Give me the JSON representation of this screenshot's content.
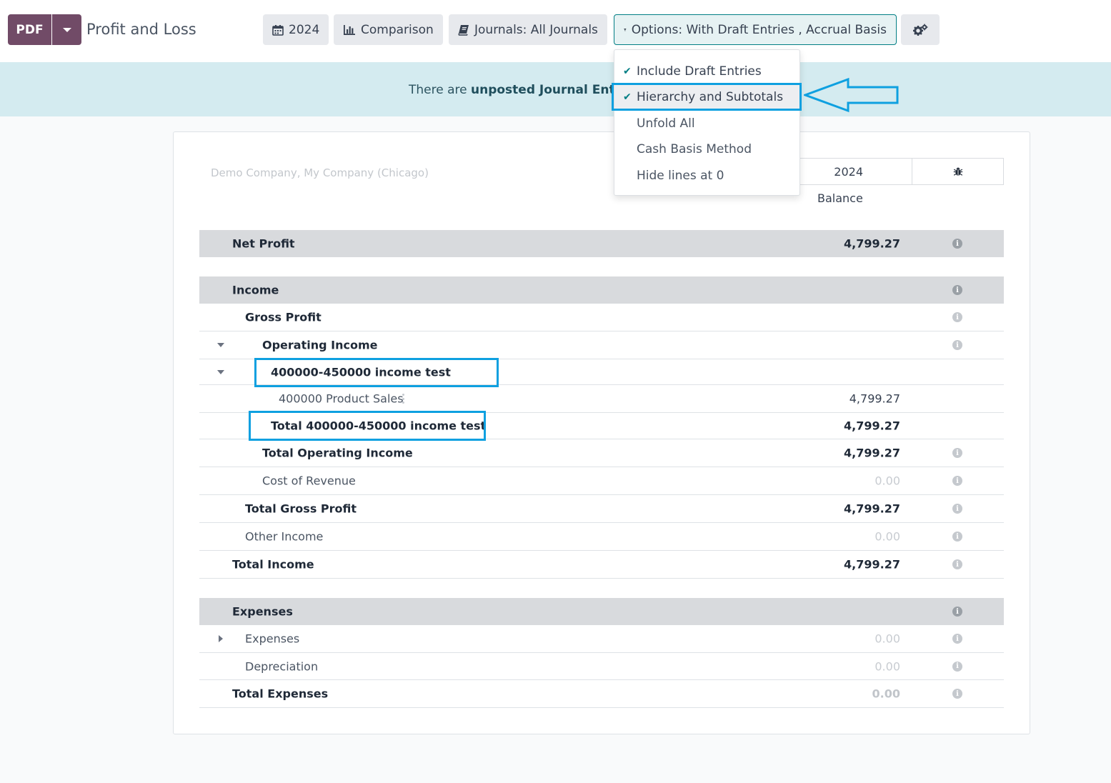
{
  "header": {
    "pdf_label": "PDF",
    "title": "Profit and Loss",
    "buttons": {
      "period": "2024",
      "comparison": "Comparison",
      "journals": "Journals: All Journals",
      "options": "Options: With Draft Entries , Accrual Basis"
    }
  },
  "banner": {
    "prefix": "There are ",
    "link": "unposted Journal Entries"
  },
  "options_menu": {
    "items": [
      {
        "label": "Include Draft Entries",
        "checked": true
      },
      {
        "label": "Hierarchy and Subtotals",
        "checked": true
      },
      {
        "label": "Unfold All",
        "checked": false
      },
      {
        "label": "Cash Basis Method",
        "checked": false
      },
      {
        "label": "Hide lines at 0",
        "checked": false
      }
    ]
  },
  "report": {
    "company": "Demo Company, My Company (Chicago)",
    "column_period": "2024",
    "column_label": "Balance",
    "rows": {
      "net_profit": {
        "label": "Net Profit",
        "value": "4,799.27"
      },
      "income": {
        "label": "Income"
      },
      "gross_profit": {
        "label": "Gross Profit"
      },
      "operating_income": {
        "label": "Operating Income"
      },
      "group": {
        "label": "400000-450000 income test"
      },
      "product_sales": {
        "label": "400000 Product Sales",
        "value": "4,799.27"
      },
      "group_total": {
        "label": "Total 400000-450000 income test",
        "value": "4,799.27"
      },
      "total_operating_income": {
        "label": "Total Operating Income",
        "value": "4,799.27"
      },
      "cost_of_revenue": {
        "label": "Cost of Revenue",
        "value": "0.00"
      },
      "total_gross_profit": {
        "label": "Total Gross Profit",
        "value": "4,799.27"
      },
      "other_income": {
        "label": "Other Income",
        "value": "0.00"
      },
      "total_income": {
        "label": "Total Income",
        "value": "4,799.27"
      },
      "expenses_section": {
        "label": "Expenses"
      },
      "expenses": {
        "label": "Expenses",
        "value": "0.00"
      },
      "depreciation": {
        "label": "Depreciation",
        "value": "0.00"
      },
      "total_expenses": {
        "label": "Total Expenses",
        "value": "0.00"
      }
    }
  },
  "colors": {
    "brand": "#714b67",
    "highlight": "#0ea0e0",
    "banner_bg": "#d4ebf0"
  }
}
